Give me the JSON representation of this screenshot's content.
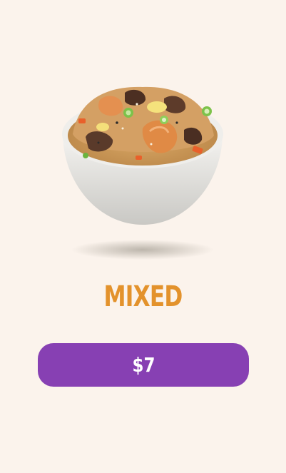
{
  "product": {
    "name": "MIXED",
    "price": "$7",
    "image": "mixed-fried-rice-bowl-image"
  },
  "colors": {
    "background": "#fbf3ec",
    "title": "#e3922c",
    "button": "#8740b3",
    "button_text": "#ffffff"
  }
}
